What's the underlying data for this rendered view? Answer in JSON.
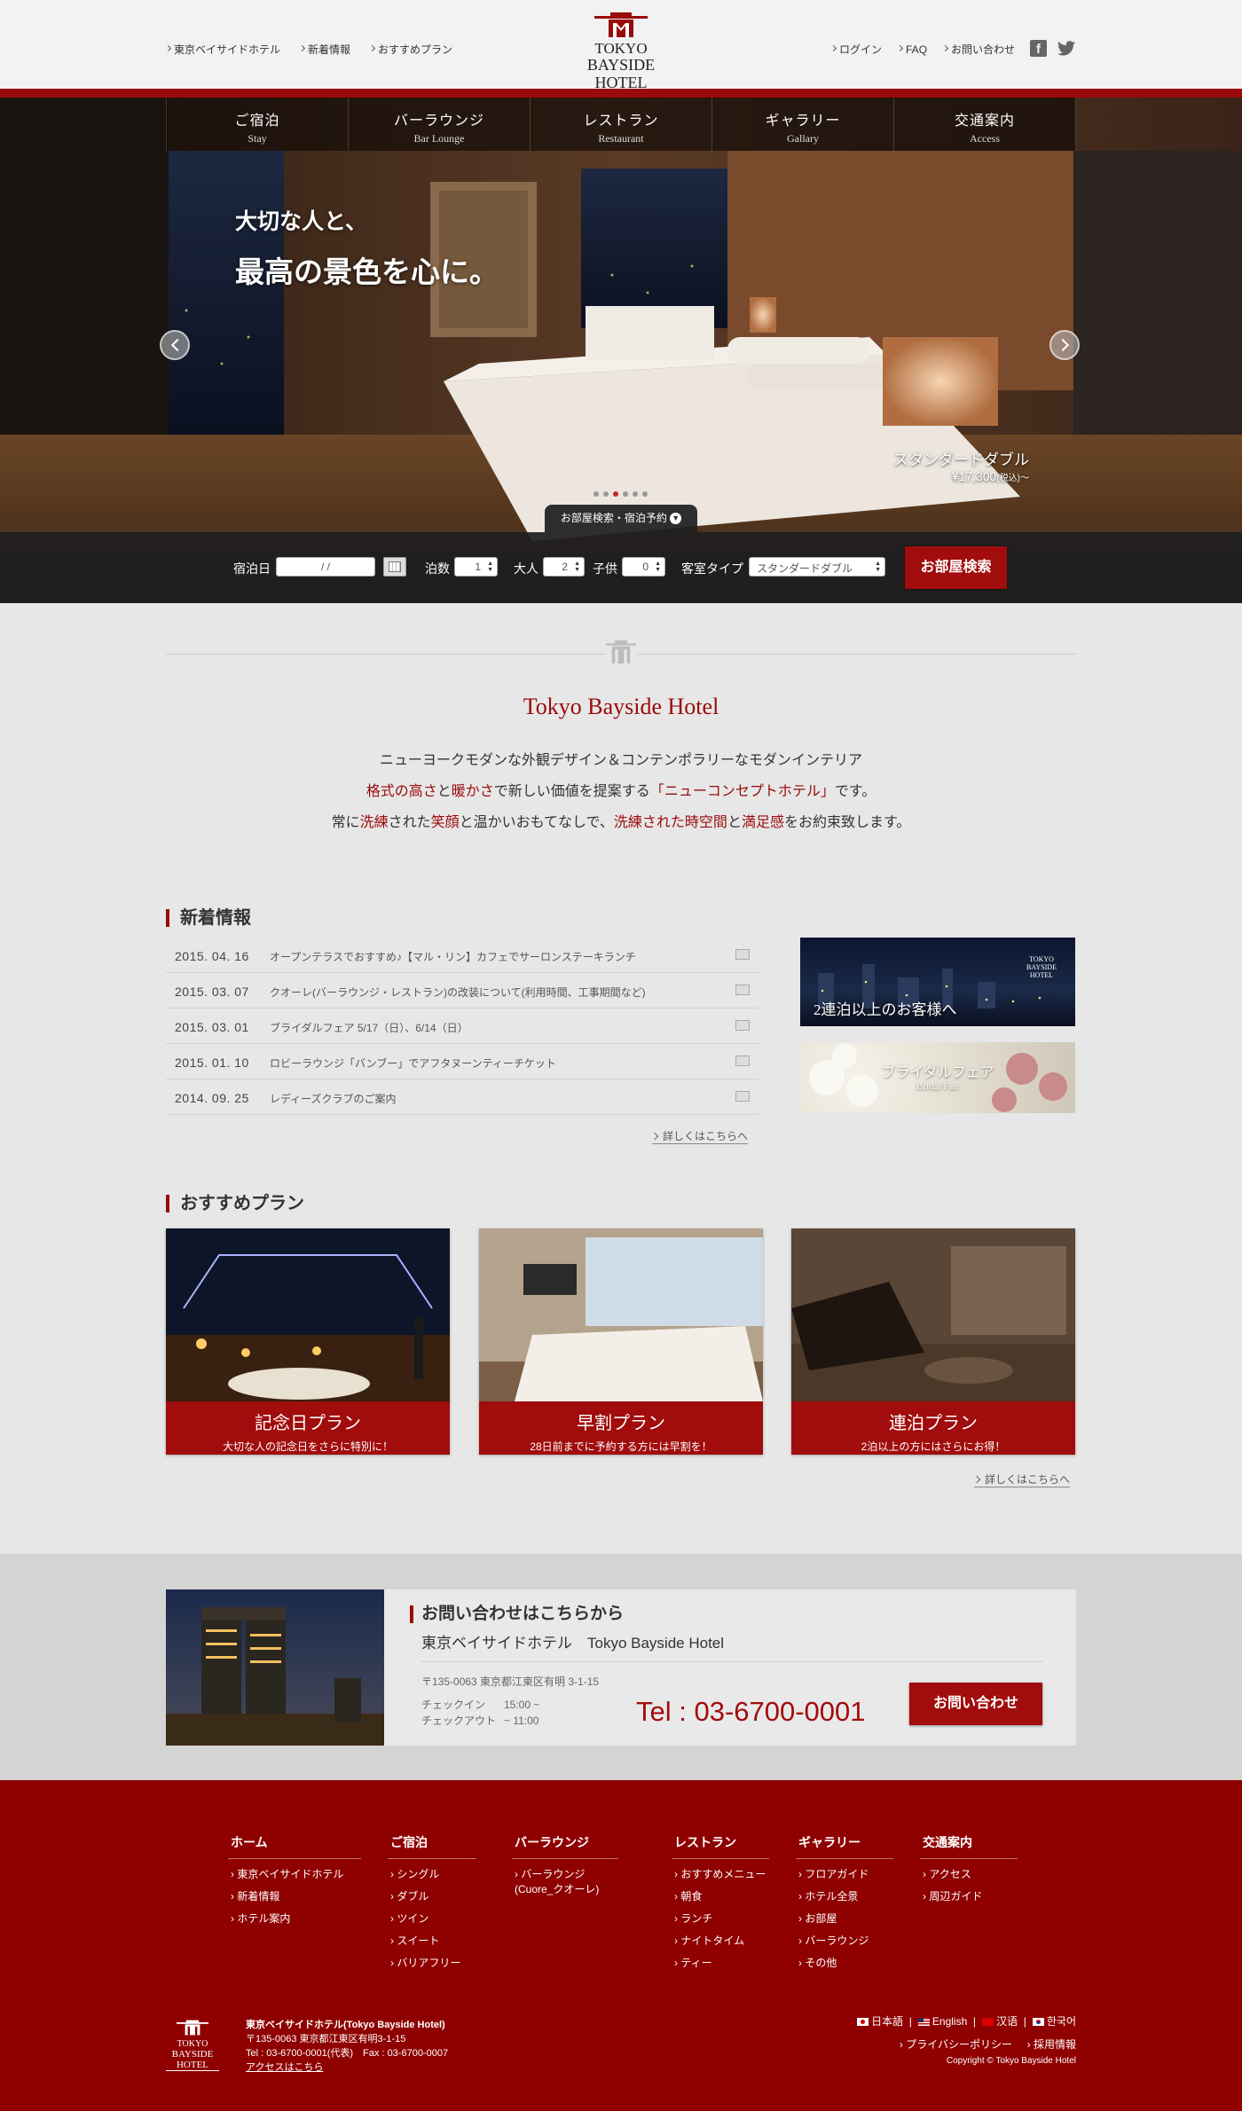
{
  "header": {
    "left_nav": [
      "東京ベイサイドホテル",
      "新着情報",
      "おすすめプラン"
    ],
    "logo_line1": "TOKYO",
    "logo_line2": "BAYSIDE HOTEL",
    "right_nav": [
      "ログイン",
      "FAQ",
      "お問い合わせ"
    ],
    "social": [
      "facebook-icon",
      "twitter-icon"
    ]
  },
  "global_nav": [
    {
      "ja": "ご宿泊",
      "en": "Stay"
    },
    {
      "ja": "バーラウンジ",
      "en": "Bar Lounge"
    },
    {
      "ja": "レストラン",
      "en": "Restaurant"
    },
    {
      "ja": "ギャラリー",
      "en": "Gallary"
    },
    {
      "ja": "交通案内",
      "en": "Access"
    }
  ],
  "hero": {
    "copy1": "大切な人と、",
    "copy2": "最高の景色を心に。",
    "room_name": "スタンダードダブル",
    "room_price": "¥17,300",
    "room_tax": "(税込)〜",
    "slide_count": 6,
    "active_slide": 3,
    "search_tab": "お部屋検索・宿泊予約"
  },
  "search": {
    "date_label": "宿泊日",
    "date_value": "/   /",
    "nights_label": "泊数",
    "nights_value": "1",
    "adult_label": "大人",
    "adult_value": "2",
    "child_label": "子供",
    "child_value": "0",
    "room_type_label": "客室タイプ",
    "room_type_value": "スタンダードダブル",
    "button": "お部屋検索"
  },
  "concept": {
    "title": "Tokyo Bayside Hotel",
    "line1": "ニューヨークモダンな外観デザイン＆コンテンポラリーなモダンインテリア",
    "line2": [
      {
        "t": "格式の高さ",
        "r": true
      },
      {
        "t": "と",
        "r": false
      },
      {
        "t": "暖かさ",
        "r": true
      },
      {
        "t": "で新しい価値を提案する",
        "r": false
      },
      {
        "t": "「ニューコンセプトホテル」",
        "r": true
      },
      {
        "t": "です。",
        "r": false
      }
    ],
    "line3": [
      {
        "t": "常に",
        "r": false
      },
      {
        "t": "洗練",
        "r": true
      },
      {
        "t": "された",
        "r": false
      },
      {
        "t": "笑顔",
        "r": true
      },
      {
        "t": "と温かいおもてなしで、",
        "r": false
      },
      {
        "t": "洗練された時空間",
        "r": true
      },
      {
        "t": "と",
        "r": false
      },
      {
        "t": "満足感",
        "r": true
      },
      {
        "t": "をお約束致します。",
        "r": false
      }
    ]
  },
  "news": {
    "title": "新着情報",
    "items": [
      {
        "date": "2015. 04. 16",
        "text": "オープンテラスでおすすめ♪【マル・リン】カフェでサーロンステーキランチ"
      },
      {
        "date": "2015. 03. 07",
        "text": "クオーレ(バーラウンジ・レストラン)の改装について(利用時間、工事期間など)"
      },
      {
        "date": "2015. 03. 01",
        "text": "ブライダルフェア 5/17（日）、6/14（日）"
      },
      {
        "date": "2015. 01. 10",
        "text": "ロビーラウンジ「バンブー」でアフタヌーンティーチケット"
      },
      {
        "date": "2014. 09. 25",
        "text": "レディーズクラブのご案内"
      }
    ],
    "more": "詳しくはこちらへ",
    "banner1": "2連泊以上のお客様へ",
    "banner1_logo1": "TOKYO",
    "banner1_logo2": "BAYSIDE HOTEL",
    "banner2_ja": "ブライダルフェア",
    "banner2_en": "Bridal Fair"
  },
  "plans": {
    "title": "おすすめプラン",
    "items": [
      {
        "name": "記念日プラン",
        "desc": "大切な人の記念日をさらに特別に！"
      },
      {
        "name": "早割プラン",
        "desc": "28日前までに予約する方には早割を！"
      },
      {
        "name": "連泊プラン",
        "desc": "2泊以上の方にはさらにお得！"
      }
    ],
    "more": "詳しくはこちらへ"
  },
  "contact": {
    "title": "お問い合わせはこちらから",
    "hotel": "東京ベイサイドホテル　Tokyo Bayside Hotel",
    "address": "〒135-0063  東京都江東区有明 3-1-15",
    "checkin_label": "チェックイン",
    "checkin": "15:00 ~",
    "checkout_label": "チェックアウト",
    "checkout": "~ 11:00",
    "tel": "Tel : 03-6700-0001",
    "button": "お問い合わせ"
  },
  "footer": {
    "cols": [
      {
        "h": "ホーム",
        "items": [
          "東京ベイサイドホテル",
          "新着情報",
          "ホテル案内"
        ]
      },
      {
        "h": "ご宿泊",
        "items": [
          "シングル",
          "ダブル",
          "ツイン",
          "スイート",
          "バリアフリー"
        ]
      },
      {
        "h": "バーラウンジ",
        "items": [
          "バーラウンジ (Cuore_クオーレ)"
        ]
      },
      {
        "h": "レストラン",
        "items": [
          "おすすめメニュー",
          "朝食",
          "ランチ",
          "ナイトタイム",
          "ティー"
        ]
      },
      {
        "h": "ギャラリー",
        "items": [
          "フロアガイド",
          "ホテル全景",
          "お部屋",
          "バーラウンジ",
          "その他"
        ]
      },
      {
        "h": "交通案内",
        "items": [
          "アクセス",
          "周辺ガイド"
        ]
      }
    ],
    "name": "東京ベイサイドホテル(Tokyo Bayside Hotel)",
    "addr": "〒135-0063 東京都江東区有明3-1-15",
    "tel": "Tel : 03-6700-0001(代表)　Fax : 03-6700-0007",
    "access": "アクセスはこちら",
    "logo1": "TOKYO",
    "logo2": "BAYSIDE HOTEL",
    "langs": [
      "日本語",
      "English",
      "汉语",
      "한국어"
    ],
    "links": [
      "プライバシーポリシー",
      "採用情報"
    ],
    "copyright": "Copyright © Tokyo Bayside Hotel"
  }
}
